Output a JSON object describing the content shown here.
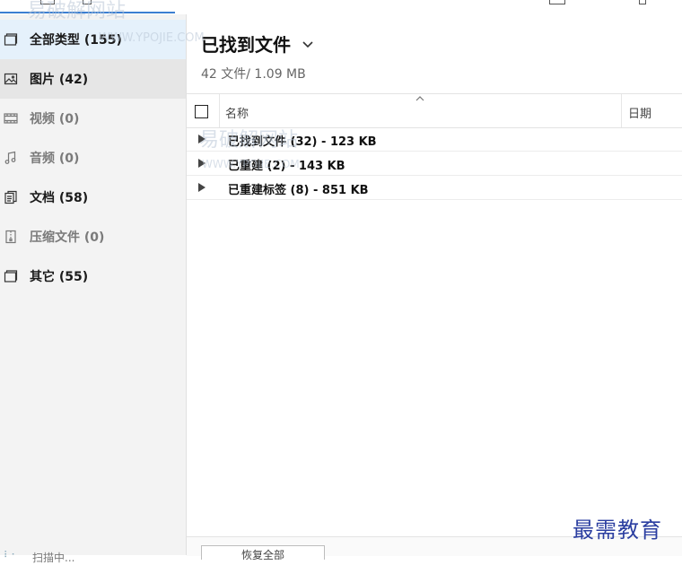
{
  "sidebar": {
    "items": [
      {
        "label": "全部类型 (155)",
        "icon": "all-types-icon",
        "state": "selected"
      },
      {
        "label": "图片 (42)",
        "icon": "image-icon",
        "state": "active"
      },
      {
        "label": "视频 (0)",
        "icon": "video-icon",
        "state": "disabled"
      },
      {
        "label": "音频 (0)",
        "icon": "audio-icon",
        "state": "disabled"
      },
      {
        "label": "文档 (58)",
        "icon": "document-icon",
        "state": "normal"
      },
      {
        "label": "压缩文件 (0)",
        "icon": "archive-icon",
        "state": "disabled"
      },
      {
        "label": "其它 (55)",
        "icon": "other-icon",
        "state": "normal"
      }
    ],
    "scan_label": "扫描中..."
  },
  "main": {
    "title": "已找到文件",
    "subtitle": "42 文件/ 1.09 MB",
    "columns": {
      "name": "名称",
      "date": "日期"
    },
    "rows": [
      {
        "label": "已找到文件 (32) - 123 KB"
      },
      {
        "label": "已重建 (2) - 143 KB"
      },
      {
        "label": "已重建标签 (8) - 851 KB"
      }
    ],
    "recover_label": "恢复全部"
  },
  "watermark": {
    "site_name": "易破解网站",
    "site_url": "WWW.YPOJIE.COM",
    "corner_text": "最需教育"
  },
  "colors": {
    "accent": "#3c7fd1",
    "selected_bg": "#e5f1fb",
    "active_bg": "#e6e6e6",
    "sidebar_bg": "#f3f3f3"
  }
}
